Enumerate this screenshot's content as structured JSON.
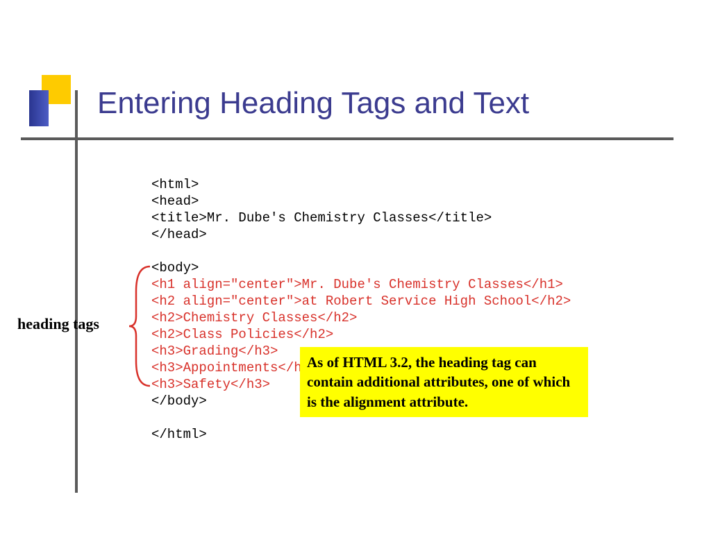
{
  "title": "Entering Heading Tags and Text",
  "code": {
    "l1": "<html>",
    "l2": "<head>",
    "l3": "<title>Mr. Dube's Chemistry Classes</title>",
    "l4": "</head>",
    "l5": "",
    "l6": "<body>",
    "h1": "<h1 align=\"center\">Mr. Dube's Chemistry Classes</h1>",
    "h2": "<h2 align=\"center\">at Robert Service High School</h2>",
    "h3": "<h2>Chemistry Classes</h2>",
    "h4": "<h2>Class Policies</h2>",
    "h5": "<h3>Grading</h3>",
    "h6": "<h3>Appointments</h3>",
    "h7": "<h3>Safety</h3>",
    "l7": "</body>",
    "l8": "",
    "l9": "</html>"
  },
  "label": "heading tags",
  "note": "As of HTML 3.2, the heading tag can contain additional attributes, one of which is the alignment attribute."
}
